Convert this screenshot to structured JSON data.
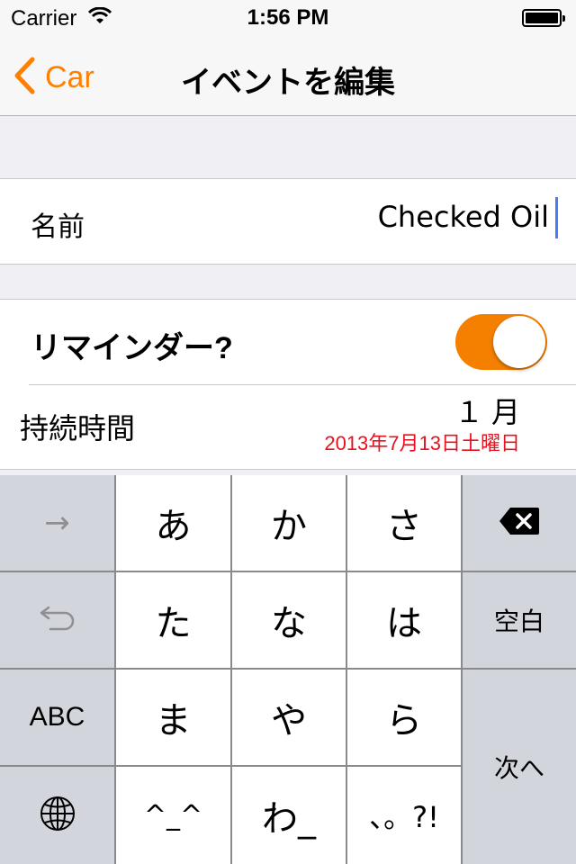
{
  "status_bar": {
    "carrier": "Carrier",
    "time": "1:56 PM",
    "wifi_icon": "wifi-icon",
    "battery_icon": "battery-icon"
  },
  "nav": {
    "back_label": "Car",
    "back_icon": "chevron-left-icon",
    "title": "イベントを編集"
  },
  "name_row": {
    "label": "名前",
    "value": "Checked Oil"
  },
  "reminder_row": {
    "label": "リマインダー?",
    "toggle_on": true
  },
  "duration_row": {
    "label": "持続時間",
    "value": "１ 月",
    "date": "2013年7月13日土曜日"
  },
  "keyboard": {
    "next_arrow": "→",
    "undo_icon": "undo-icon",
    "abc": "ABC",
    "globe_icon": "globe-icon",
    "keys": {
      "a": "あ",
      "ka": "か",
      "sa": "さ",
      "ta": "た",
      "na": "な",
      "ha": "は",
      "ma": "ま",
      "ya": "や",
      "ra": "ら",
      "emoji": "^_^",
      "wa": "わ_",
      "punct": "、。?!"
    },
    "delete_icon": "delete-icon",
    "space": "空白",
    "next": "次へ"
  },
  "colors": {
    "accent": "#ff8000",
    "toggle_on": "#f58000",
    "date_red": "#e8121f",
    "caret": "#4a7bf7"
  }
}
